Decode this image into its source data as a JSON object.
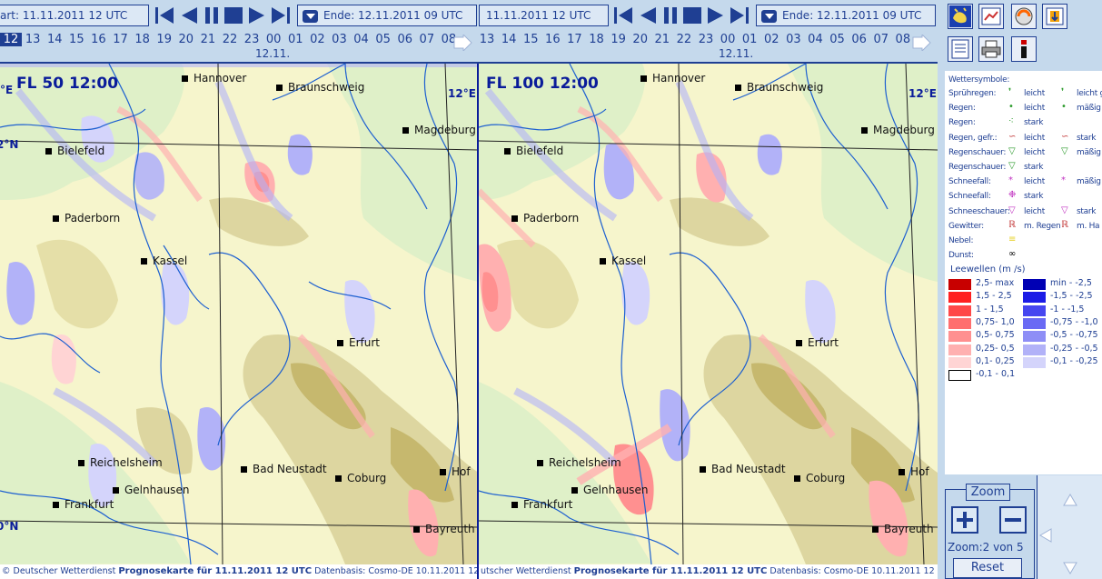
{
  "left": {
    "start": "art:  11.11.2011 12 UTC",
    "end": "Ende: 12.11.2011 09 UTC",
    "hours": [
      "12",
      "13",
      "14",
      "15",
      "16",
      "17",
      "18",
      "19",
      "20",
      "21",
      "22",
      "23",
      "00",
      "01",
      "02",
      "03",
      "04",
      "05",
      "06",
      "07",
      "08"
    ],
    "current_hour_index": 0,
    "date_label": "12.11.",
    "title": "FL 50 12:00",
    "footer_copy": "© Deutscher Wetterdienst ",
    "footer_bold": "Prognosekarte für  11.11.2011 12 UTC",
    "footer_rest": " Datenbasis: Cosmo-DE 10.11.2011 12 UTC",
    "grid": {
      "lon_e": "°E",
      "lat_n": "2°N",
      "lat_s": "0°N"
    }
  },
  "right": {
    "start": "11.11.2011 12 UTC",
    "end": "Ende: 12.11.2011 09 UTC",
    "hours": [
      "13",
      "14",
      "15",
      "16",
      "17",
      "18",
      "19",
      "20",
      "21",
      "22",
      "23",
      "00",
      "01",
      "02",
      "03",
      "04",
      "05",
      "06",
      "07",
      "08"
    ],
    "date_label": "12.11.",
    "title": "FL 100 12:00",
    "footer_copy": "utscher Wetterdienst ",
    "footer_bold": "Prognosekarte für  11.11.2011 12 UTC",
    "footer_rest": " Datenbasis: Cosmo-DE 10.11.2011 12 UTC",
    "grid": {
      "lon_e": "12°E"
    }
  },
  "cities": [
    "Hannover",
    "Braunschweig",
    "Magdeburg",
    "Bielefeld",
    "Paderborn",
    "Kassel",
    "Erfurt",
    "Reichelsheim",
    "Bad Neustadt",
    "Coburg",
    "Hof",
    "Gelnhausen",
    "Frankfurt",
    "Bayreuth"
  ],
  "grid_right_label": "12°E",
  "legend": {
    "title": "Wettersymbole:",
    "rows": [
      {
        "label": "Sprühregen:",
        "a": "leicht",
        "b": "leicht g"
      },
      {
        "label": "Regen:",
        "a": "leicht",
        "b": "mäßig"
      },
      {
        "label": "Regen:",
        "a": "stark",
        "b": ""
      },
      {
        "label": "Regen, gefr.:",
        "a": "leicht",
        "b": "stark"
      },
      {
        "label": "Regenschauer:",
        "a": "leicht",
        "b": "mäßig"
      },
      {
        "label": "Regenschauer:",
        "a": "stark",
        "b": ""
      },
      {
        "label": "Schneefall:",
        "a": "leicht",
        "b": "mäßig"
      },
      {
        "label": "Schneefall:",
        "a": "stark",
        "b": ""
      },
      {
        "label": "Schneeschauer:",
        "a": "leicht",
        "b": "stark"
      },
      {
        "label": "Gewitter:",
        "a": "m. Regen",
        "b": "m. Ha"
      },
      {
        "label": "Nebel:",
        "a": "",
        "b": ""
      },
      {
        "label": "Dunst:",
        "a": "",
        "b": ""
      }
    ],
    "leewellen_title": "Leewellen (m /s)",
    "positive": [
      {
        "label": "2,5- max",
        "color": "#c80000"
      },
      {
        "label": "1,5 - 2,5",
        "color": "#ff2020"
      },
      {
        "label": "1 - 1,5",
        "color": "#ff4848"
      },
      {
        "label": "0,75- 1,0",
        "color": "#ff6e6e"
      },
      {
        "label": "0,5- 0,75",
        "color": "#ff9090"
      },
      {
        "label": "0,25- 0,5",
        "color": "#ffb0b0"
      },
      {
        "label": "0,1- 0,25",
        "color": "#ffd4d4"
      },
      {
        "label": "-0,1 - 0,1",
        "color": "#ffffff"
      }
    ],
    "negative": [
      {
        "label": "min -  -2,5",
        "color": "#0000b4"
      },
      {
        "label": "-1,5 -  -2,5",
        "color": "#1c1ce6"
      },
      {
        "label": "-1 -  -1,5",
        "color": "#4646f0"
      },
      {
        "label": "-0,75 -  -1,0",
        "color": "#6a6af4"
      },
      {
        "label": "-0,5 -  -0,75",
        "color": "#8e8ef6"
      },
      {
        "label": "-0,25 -  -0,5",
        "color": "#b2b2f8"
      },
      {
        "label": "-0,1 -  -0,25",
        "color": "#d4d4fb"
      }
    ]
  },
  "zoom": {
    "title": "Zoom",
    "label": "Zoom:2 von 5",
    "reset": "Reset"
  },
  "colors": {
    "ui_blue": "#1f3f93",
    "panel_bg": "#c5d9ec",
    "map_bg": "#f6f5cc",
    "terrain": "#ddd6a0",
    "terrain_dark": "#c6b86e",
    "green": "#dff0c8",
    "rivers": "#1c5fd0"
  }
}
